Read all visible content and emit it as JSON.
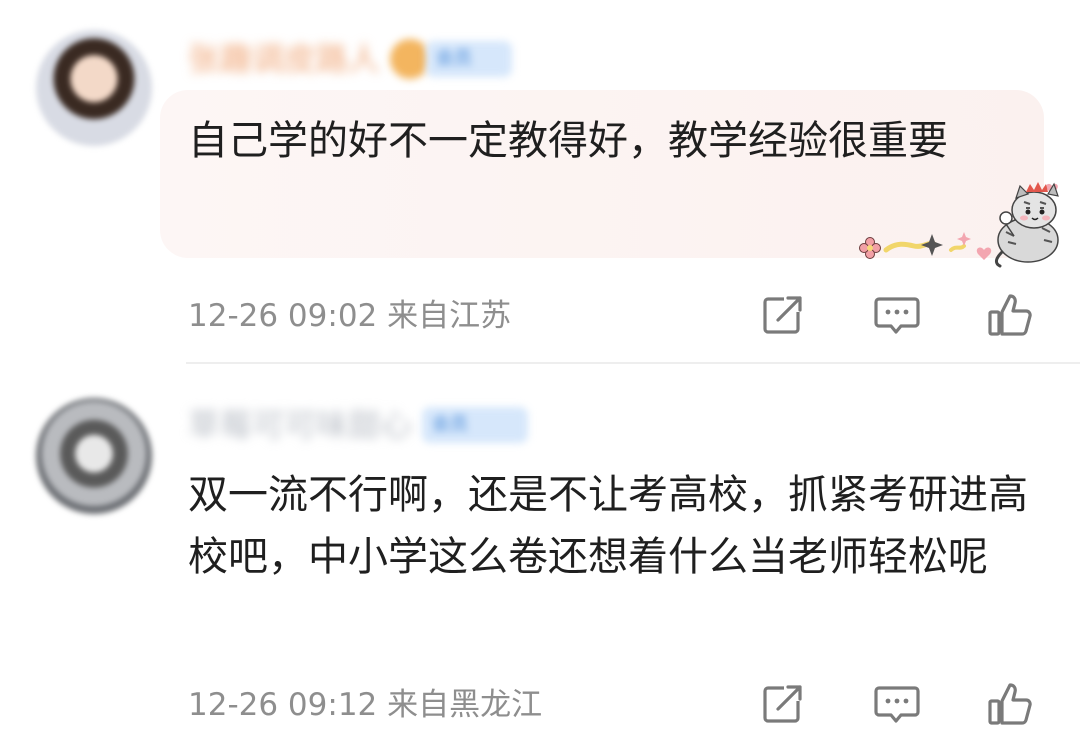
{
  "comments": [
    {
      "username": "张趣调皮路人",
      "badge": "会员",
      "text": "自己学的好不一定教得好，教学经验很重要",
      "time": "12-26 09:02",
      "location": "来自江苏"
    },
    {
      "username": "草莓可可味甜心",
      "badge": "会员",
      "text": "双一流不行啊，还是不让考高校，抓紧考研进高校吧，中小学这么卷还想着什么当老师轻松呢",
      "time": "12-26 09:12",
      "location": "来自黑龙江"
    }
  ],
  "icons": {
    "share": "share-icon",
    "reply": "reply-icon",
    "like": "like-icon",
    "sticker": "cat-sticker-icon"
  },
  "colors": {
    "meta": "#8e8e8e",
    "icon": "#7a7a7a",
    "bubble": "#fbf1ef",
    "badge_bg": "#d6e7fb"
  }
}
